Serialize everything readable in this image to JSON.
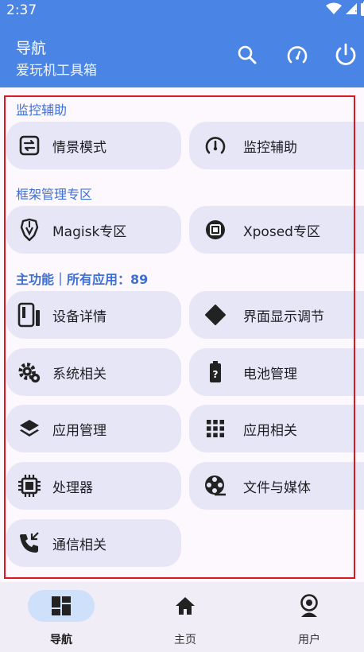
{
  "status_bar": {
    "time": "2:37"
  },
  "app_bar": {
    "title": "导航",
    "subtitle": "爱玩机工具箱",
    "actions": [
      "search-icon",
      "speedometer-icon",
      "power-icon"
    ]
  },
  "sections": [
    {
      "title": "监控辅助",
      "items": [
        {
          "label": "情景模式",
          "icon": "scene-switch-icon"
        },
        {
          "label": "监控辅助",
          "icon": "speedometer-icon"
        }
      ]
    },
    {
      "title": "框架管理专区",
      "items": [
        {
          "label": "Magisk专区",
          "icon": "magisk-icon"
        },
        {
          "label": "Xposed专区",
          "icon": "chip-icon"
        }
      ]
    },
    {
      "title": "主功能｜所有应用：",
      "count": "89",
      "items": [
        {
          "label": "设备详情",
          "icon": "device-icon"
        },
        {
          "label": "界面显示调节",
          "icon": "display-icon"
        },
        {
          "label": "系统相关",
          "icon": "system-gear-icon"
        },
        {
          "label": "电池管理",
          "icon": "battery-icon"
        },
        {
          "label": "应用管理",
          "icon": "layers-icon"
        },
        {
          "label": "应用相关",
          "icon": "grid-icon"
        },
        {
          "label": "处理器",
          "icon": "processor-icon"
        },
        {
          "label": "文件与媒体",
          "icon": "film-reel-icon"
        },
        {
          "label": "通信相关",
          "icon": "phone-icon"
        }
      ]
    }
  ],
  "bottom_nav": {
    "items": [
      {
        "label": "导航",
        "icon": "dashboard-icon",
        "active": true
      },
      {
        "label": "主页",
        "icon": "home-icon",
        "active": false
      },
      {
        "label": "用户",
        "icon": "user-icon",
        "active": false
      }
    ]
  },
  "colors": {
    "primary": "#4a84e4",
    "section_title": "#3d6fd6",
    "card_bg": "#e7e6f7",
    "highlight_frame": "#e0161e"
  }
}
